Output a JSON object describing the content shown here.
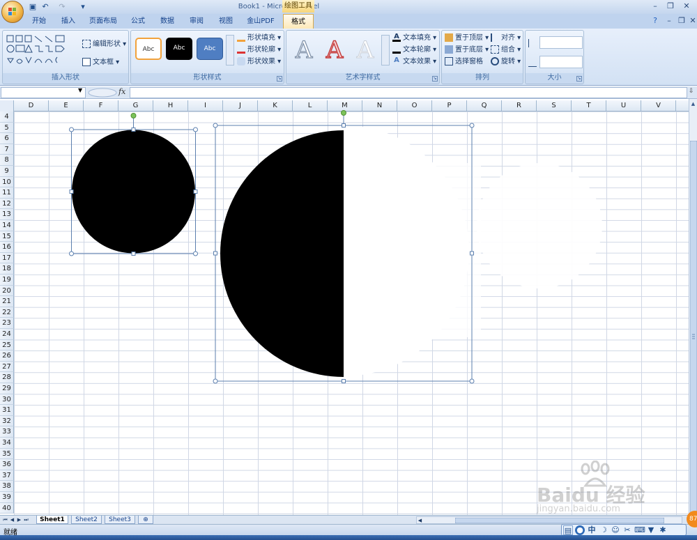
{
  "window": {
    "title": "Book1 - Microsoft Excel",
    "context_tab_group": "绘图工具"
  },
  "qat": {
    "save_icon": "save-icon",
    "undo_icon": "undo-icon",
    "redo_icon": "redo-icon",
    "customize_icon": "chevron-down-icon"
  },
  "tabs": [
    {
      "label": "开始"
    },
    {
      "label": "插入"
    },
    {
      "label": "页面布局"
    },
    {
      "label": "公式"
    },
    {
      "label": "数据"
    },
    {
      "label": "审阅"
    },
    {
      "label": "视图"
    },
    {
      "label": "金山PDF"
    },
    {
      "label": "格式",
      "active": true
    }
  ],
  "ribbon": {
    "insert_shapes": {
      "label": "插入形状",
      "edit_shape": "编辑形状",
      "text_box": "文本框"
    },
    "shape_styles": {
      "label": "形状样式",
      "swatch_text": "Abc",
      "shape_fill": "形状填充",
      "shape_outline": "形状轮廓",
      "shape_effects": "形状效果"
    },
    "wordart_styles": {
      "label": "艺术字样式",
      "sample": "A",
      "text_fill": "文本填充",
      "text_outline": "文本轮廓",
      "text_effects": "文本效果"
    },
    "arrange": {
      "label": "排列",
      "bring_front": "置于顶层",
      "send_back": "置于底层",
      "selection_pane": "选择窗格",
      "align": "对齐",
      "group": "组合",
      "rotate": "旋转"
    },
    "size": {
      "label": "大小",
      "height_value": "",
      "width_value": ""
    }
  },
  "formula_bar": {
    "name_box_value": "",
    "fx_label": "fx",
    "formula_value": ""
  },
  "columns": [
    "D",
    "E",
    "F",
    "G",
    "H",
    "I",
    "J",
    "K",
    "L",
    "M",
    "N",
    "O",
    "P",
    "Q",
    "R",
    "S",
    "T",
    "U",
    "V"
  ],
  "rows": [
    "4",
    "5",
    "6",
    "7",
    "8",
    "9",
    "10",
    "11",
    "12",
    "13",
    "14",
    "15",
    "16",
    "17",
    "18",
    "19",
    "20",
    "21",
    "22",
    "23",
    "24",
    "25",
    "26",
    "27",
    "28",
    "29",
    "30",
    "31",
    "32",
    "33",
    "34",
    "35",
    "36",
    "37",
    "38",
    "39",
    "40"
  ],
  "sheets": [
    {
      "name": "Sheet1",
      "active": true
    },
    {
      "name": "Sheet2"
    },
    {
      "name": "Sheet3"
    }
  ],
  "status": {
    "ready_text": "就绪"
  },
  "ime": {
    "lang": "中",
    "icons": [
      "user-icon",
      "moon-icon",
      "smile-icon",
      "tools-icon",
      "keyboard-icon",
      "shirt-icon",
      "gear-icon"
    ]
  },
  "watermark": {
    "text": "Baidu 经验",
    "sub": "jingyan.baidu.com"
  },
  "colors": {
    "shape_fill": "#000000",
    "selection_handle": "#5b7fae",
    "rotate_handle": "#7dc35a"
  }
}
